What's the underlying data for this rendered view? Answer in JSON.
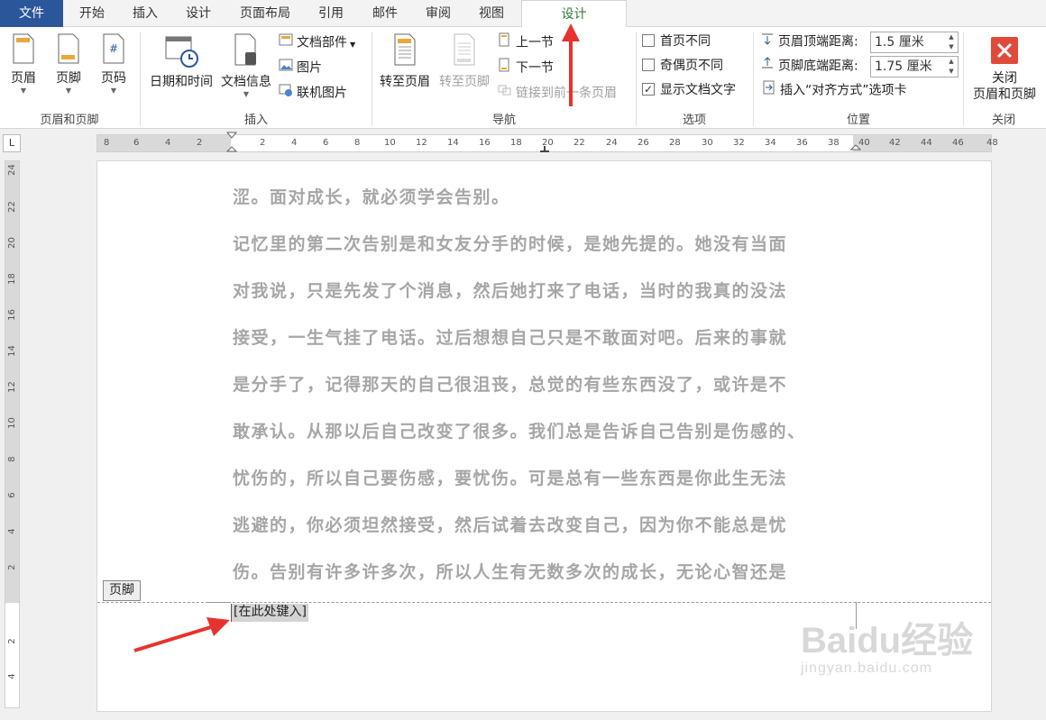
{
  "tabs": [
    {
      "label": "文件"
    },
    {
      "label": "开始"
    },
    {
      "label": "插入"
    },
    {
      "label": "设计"
    },
    {
      "label": "页面布局"
    },
    {
      "label": "引用"
    },
    {
      "label": "邮件"
    },
    {
      "label": "审阅"
    },
    {
      "label": "视图"
    },
    {
      "label": "设计"
    }
  ],
  "ribbon": {
    "header_footer": {
      "header": "页眉",
      "footer": "页脚",
      "page_number": "页码",
      "group": "页眉和页脚"
    },
    "insert": {
      "date_time": "日期和时间",
      "doc_info": "文档信息",
      "quick_parts": "文档部件",
      "picture": "图片",
      "online_picture": "联机图片",
      "group": "插入"
    },
    "navigation": {
      "goto_header": "转至页眉",
      "goto_footer": "转至页脚",
      "previous": "上一节",
      "next": "下一节",
      "link_previous": "链接到前一条页眉",
      "group": "导航"
    },
    "options": {
      "different_first": "首页不同",
      "different_odd_even": "奇偶页不同",
      "show_doc_text": "显示文档文字",
      "group": "选项"
    },
    "position": {
      "header_top_label": "页眉顶端距离:",
      "header_top_value": "1.5 厘米",
      "footer_bottom_label": "页脚底端距离:",
      "footer_bottom_value": "1.75 厘米",
      "insert_align_tab": "插入“对齐方式”选项卡",
      "group": "位置"
    },
    "close": {
      "line1": "关闭",
      "line2": "页眉和页脚",
      "group": "关闭"
    }
  },
  "ruler": {
    "corner": "L",
    "h_ticks": [
      "8",
      "6",
      "4",
      "2",
      "2",
      "4",
      "6",
      "8",
      "10",
      "12",
      "14",
      "16",
      "18",
      "20",
      "22",
      "24",
      "26",
      "28",
      "30",
      "32",
      "34",
      "36",
      "38",
      "40",
      "42",
      "44",
      "46",
      "48"
    ],
    "v_ticks": [
      "24",
      "22",
      "20",
      "18",
      "16",
      "14",
      "12",
      "10",
      "8",
      "6",
      "4",
      "2",
      "2",
      "4"
    ]
  },
  "document": {
    "lines": [
      "涩。面对成长，就必须学会告别。",
      "记忆里的第二次告别是和女友分手的时候，是她先提的。她没有当面",
      "对我说，只是先发了个消息，然后她打来了电话，当时的我真的没法",
      "接受，一生气挂了电话。过后想想自己只是不敢面对吧。后来的事就",
      "是分手了，记得那天的自己很沮丧，总觉的有些东西没了，或许是不",
      "敢承认。从那以后自己改变了很多。我们总是告诉自己告别是伤感的、",
      "忧伤的，所以自己要伤感，要忧伤。可是总有一些东西是你此生无法",
      "逃避的，你必须坦然接受，然后试着去改变自己，因为你不能总是忧",
      "伤。告别有许多许多次，所以人生有无数多次的成长，无论心智还是"
    ],
    "footer_tag": "页脚",
    "footer_placeholder": "[在此处键入]"
  },
  "watermark": {
    "line1": "Baidu经验",
    "line2": "jingyan.baidu.com"
  },
  "colors": {
    "file_tab": "#2b579a",
    "active_tab_text": "#2e7d32",
    "arrow": "#e8322d",
    "close_button": "#e04a3a"
  }
}
